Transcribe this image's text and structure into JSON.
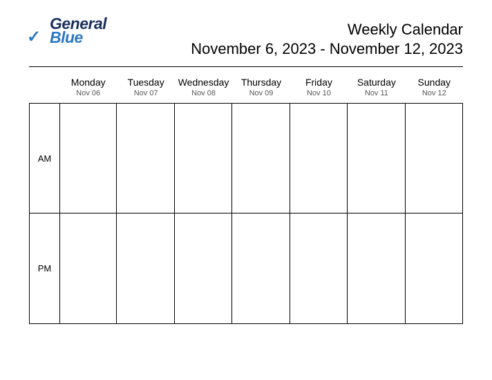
{
  "logo": {
    "word1": "General",
    "word2": "Blue"
  },
  "header": {
    "title": "Weekly Calendar",
    "date_range": "November 6, 2023 - November 12, 2023"
  },
  "periods": {
    "am": "AM",
    "pm": "PM"
  },
  "days": [
    {
      "name": "Monday",
      "date": "Nov 06"
    },
    {
      "name": "Tuesday",
      "date": "Nov 07"
    },
    {
      "name": "Wednesday",
      "date": "Nov 08"
    },
    {
      "name": "Thursday",
      "date": "Nov 09"
    },
    {
      "name": "Friday",
      "date": "Nov 10"
    },
    {
      "name": "Saturday",
      "date": "Nov 11"
    },
    {
      "name": "Sunday",
      "date": "Nov 12"
    }
  ]
}
